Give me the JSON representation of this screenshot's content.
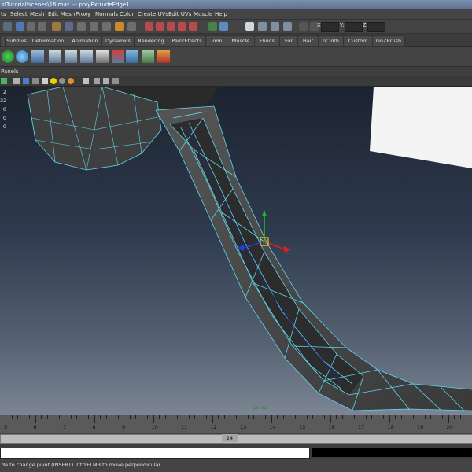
{
  "window": {
    "title": "s\\Tutorial\\scenes\\16.ma*   ---   polyExtrudeEdge1..."
  },
  "menubar": {
    "items": [
      "ts",
      "Select",
      "Mesh",
      "Edit Mesh",
      "Proxy",
      "Normals",
      "Color",
      "Create UVs",
      "Edit UVs",
      "Muscle",
      "Help"
    ]
  },
  "statusline": {
    "x_label": "X:",
    "y_label": "Y:",
    "z_label": "Z:"
  },
  "shelf_tabs": [
    "Subdivs",
    "Deformation",
    "Animation",
    "Dynamics",
    "Rendering",
    "PaintEffects",
    "Toon",
    "Muscle",
    "Fluids",
    "Fur",
    "Hair",
    "nCloth",
    "Custom",
    "GoZBrush"
  ],
  "panel_menu": {
    "label": "Panels"
  },
  "hud": {
    "values": [
      "2",
      "32",
      "0",
      "0",
      "0"
    ]
  },
  "viewport": {
    "axis_label": "persp"
  },
  "timeline": {
    "ticks": [
      "5",
      "6",
      "7",
      "8",
      "9",
      "10",
      "11",
      "12",
      "13",
      "14",
      "15",
      "16",
      "17",
      "18",
      "19",
      "20"
    ]
  },
  "range": {
    "value": "24"
  },
  "helpline": {
    "text": "de to change pivot (INSERT).  Ctrl+LMB to move perpendicular"
  },
  "colors": {
    "wire": "#5fd7ee",
    "mesh": "#4a4a4a",
    "manip_x": "#e02020",
    "manip_y": "#20c020",
    "manip_z": "#2040e0",
    "pivot": "#f5d200"
  }
}
